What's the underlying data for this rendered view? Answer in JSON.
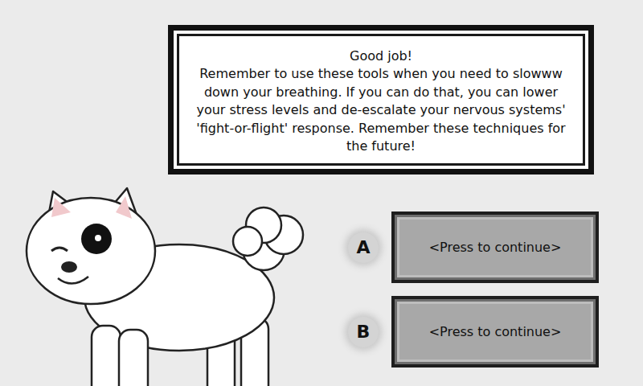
{
  "dialog": {
    "title": "Good job!",
    "message": "Remember to use these tools when you need to slowww down your breathing. If you can do that, you can lower your stress levels and de-escalate your nervous systems' 'fight-or-flight' response. Remember these techniques for the future!"
  },
  "choices": [
    {
      "key": "A",
      "label": "<Press to continue>"
    },
    {
      "key": "B",
      "label": "<Press to continue>"
    }
  ]
}
